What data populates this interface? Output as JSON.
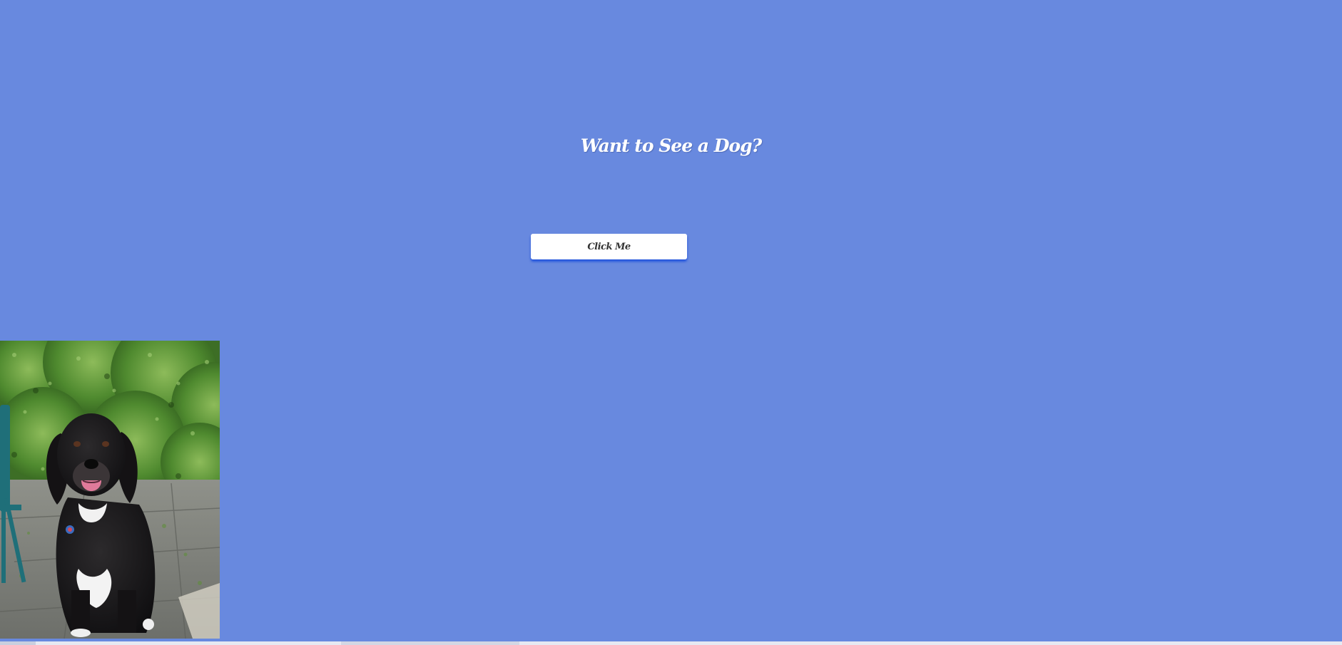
{
  "page": {
    "title": "Want to See a Dog?",
    "background_color": "#6889df"
  },
  "button": {
    "label": "Click Me",
    "shadow_color": "#1e50dc"
  },
  "image": {
    "subject": "dog-photo",
    "description_icon": "dog-photo-image"
  }
}
